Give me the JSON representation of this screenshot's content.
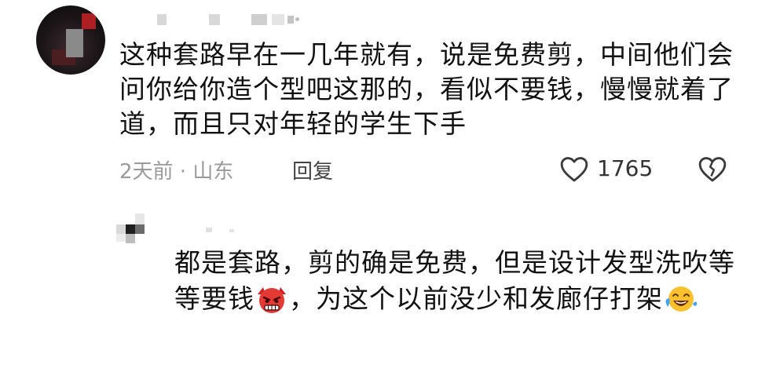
{
  "comment": {
    "text": "这种套路早在一几年就有，说是免费剪，中间他们会问你给你造个型吧这那的，看似不要钱，慢慢就着了道，而且只对年轻的学生下手",
    "meta": "2天前 · 山东",
    "reply_label": "回复",
    "like_count": "1765",
    "icons": {
      "like": "heart-outline-icon",
      "dislike": "broken-heart-icon"
    }
  },
  "reply": {
    "text_part1": "都是套路，剪的确是免费，但是设计发型洗吹等等要钱",
    "emoji1": "angry-face-emoji",
    "text_part2": "，为这个以前没少和发廊仔打架",
    "emoji2": "laughing-tears-emoji"
  }
}
